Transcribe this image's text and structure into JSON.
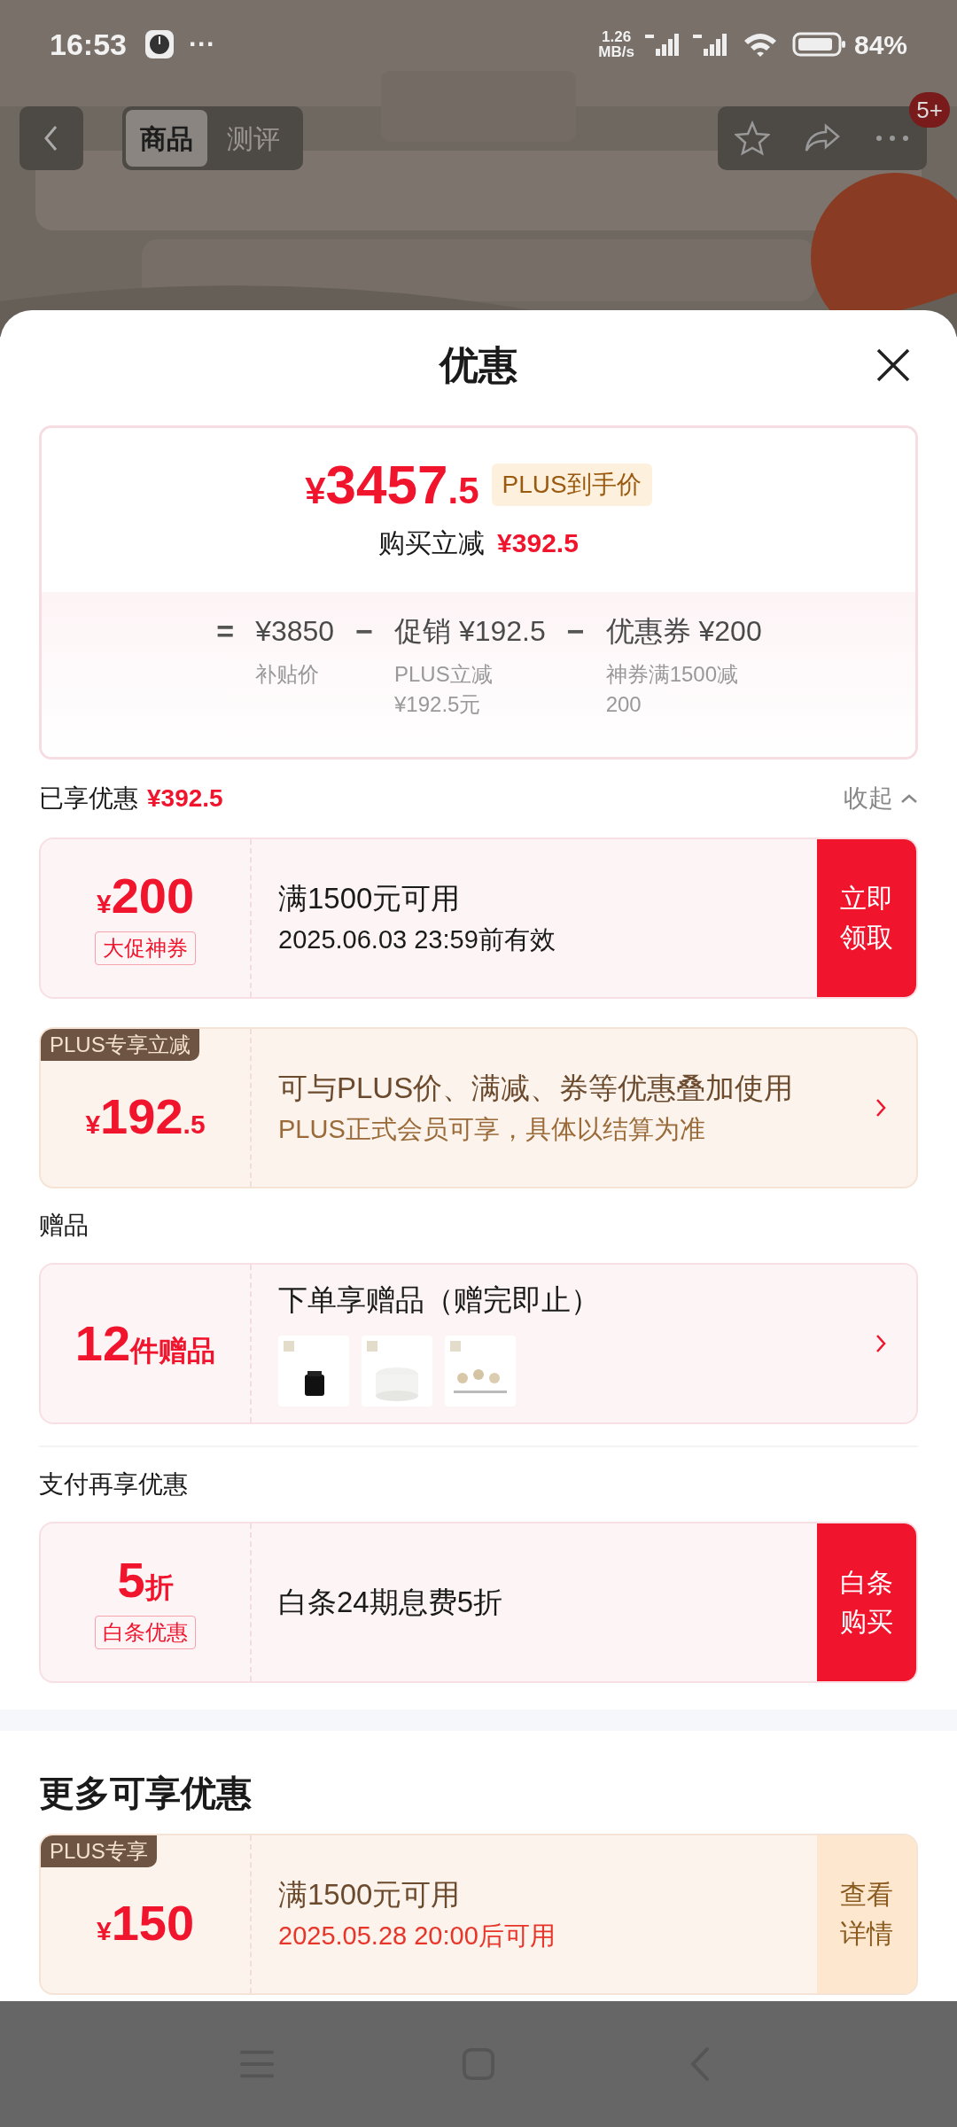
{
  "status_bar": {
    "time": "16:53",
    "more_notifications": "···",
    "net_speed": [
      "1.26",
      "MB/s"
    ],
    "battery": "84%"
  },
  "top_nav": {
    "tabs": [
      {
        "label": "商品",
        "selected": true
      },
      {
        "label": "测评",
        "selected": false
      }
    ],
    "badge": "5+"
  },
  "sheet": {
    "title": "优惠",
    "price_summary": {
      "currency": "¥",
      "price": "3457",
      "decimal": ".5",
      "tag": "PLUS到手价",
      "reduction_label": "购买立减",
      "reduction_amount": "¥392.5",
      "breakdown": [
        {
          "operator": "=",
          "value": "¥3850",
          "note": [
            "补贴价"
          ]
        },
        {
          "operator": "−",
          "value": "促销 ¥192.5",
          "note": [
            "PLUS立减",
            "¥192.5元"
          ]
        },
        {
          "operator": "−",
          "value": "优惠券 ¥200",
          "note": [
            "神券满1500减",
            "200"
          ]
        }
      ]
    },
    "enjoyed": {
      "label": "已享优惠",
      "amount": "¥392.5",
      "toggle": "收起"
    },
    "sections": [
      {
        "cards": [
          {
            "kind": "red",
            "currency": "¥",
            "amount": "200",
            "tag": "大促神券",
            "title": "满1500元可用",
            "subtitle": "2025.06.03 23:59前有效",
            "action": "立即领取"
          },
          {
            "kind": "plus",
            "ribbon": "PLUS专享立减",
            "currency": "¥",
            "amount": "192",
            "decimal": ".5",
            "title": "可与PLUS价、满减、券等优惠叠加使用",
            "subtitle": "PLUS正式会员可享，具体以结算为准"
          }
        ]
      },
      {
        "title": "赠品",
        "cards": [
          {
            "kind": "red",
            "amount": "12",
            "unit": "件赠品",
            "title": "下单享赠品（赠完即止）"
          }
        ]
      },
      {
        "title": "支付再享优惠",
        "cards": [
          {
            "kind": "red",
            "amount": "5",
            "unit": "折",
            "tag": "白条优惠",
            "title": "白条24期息费5折",
            "action": "白条购买"
          }
        ]
      },
      {
        "title": "更多可享优惠",
        "major": true,
        "cards": [
          {
            "kind": "plus",
            "ribbon": "PLUS专享",
            "currency": "¥",
            "amount": "150",
            "title": "满1500元可用",
            "subtitle": "2025.05.28 20:00后可用",
            "subtitle_alert": true,
            "action": "查看详情"
          }
        ]
      }
    ]
  }
}
